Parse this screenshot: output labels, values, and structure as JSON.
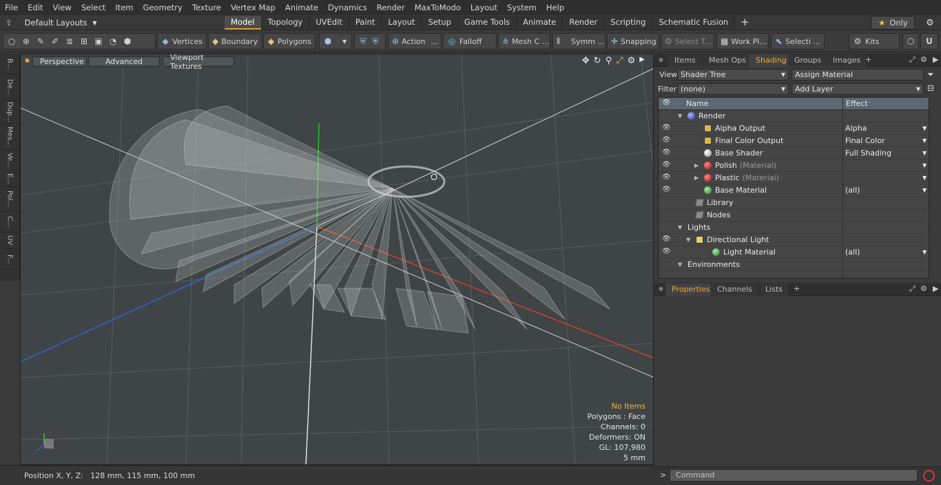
{
  "menu": [
    "File",
    "Edit",
    "View",
    "Select",
    "Item",
    "Geometry",
    "Texture",
    "Vertex Map",
    "Animate",
    "Dynamics",
    "Render",
    "MaxToModo",
    "Layout",
    "System",
    "Help"
  ],
  "layout": {
    "selector": "Default Layouts",
    "tabs": [
      "Model",
      "Topology",
      "UVEdit",
      "Paint",
      "Layout",
      "Setup",
      "Game Tools",
      "Animate",
      "Render",
      "Scripting",
      "Schematic Fusion"
    ],
    "active_tab": "Model",
    "only_label": "Only"
  },
  "toolbar": {
    "vertices": "Vertices",
    "boundary": "Boundary",
    "polygons": "Polygons",
    "action": "Action",
    "falloff": "Falloff",
    "mesh": "Mesh C ...",
    "symm": "Symm ...",
    "snapping": "Snapping",
    "select_t": "Select T...",
    "work_pl": "Work Pl...",
    "selecti": "Selecti ...",
    "kits": "Kits"
  },
  "left_tabs": [
    "B...",
    "De...",
    "Dup...",
    "Mes...",
    "Ve...",
    "E...",
    "Pol...",
    "C...",
    "UV",
    "F..."
  ],
  "viewport": {
    "perspective": "Perspective",
    "advanced": "Advanced",
    "textures": "Viewport Textures",
    "stats": {
      "no_items": "No Items",
      "polygons": "Polygons : Face",
      "channels": "Channels: 0",
      "deformers": "Deformers: ON",
      "gl": "GL: 107,980",
      "scale": "5 mm"
    }
  },
  "status": {
    "position": "Position X, Y, Z:   128 mm, 115 mm, 100 mm"
  },
  "right": {
    "tabs": [
      "Items",
      "Mesh Ops",
      "Shading",
      "Groups",
      "Images"
    ],
    "active_tab": "Shading",
    "view_label": "View",
    "view_value": "Shader Tree",
    "assign": "Assign Material",
    "filter_label": "Filter",
    "filter_value": "(none)",
    "add_layer": "Add Layer",
    "col_name": "Name",
    "col_effect": "Effect",
    "rows": [
      {
        "name": "Render",
        "sub": "",
        "effect": "",
        "eye": false,
        "exp": "▼",
        "ind": 0,
        "icon": "sphere-blue"
      },
      {
        "name": "Alpha Output",
        "sub": "",
        "effect": "Alpha",
        "eye": true,
        "exp": "",
        "ind": 2,
        "icon": "output"
      },
      {
        "name": "Final Color Output",
        "sub": "",
        "effect": "Final Color",
        "eye": true,
        "exp": "",
        "ind": 2,
        "icon": "output"
      },
      {
        "name": "Base Shader",
        "sub": "",
        "effect": "Full Shading",
        "eye": true,
        "exp": "",
        "ind": 2,
        "icon": "sphere-white"
      },
      {
        "name": "Polish",
        "sub": "(Material)",
        "effect": "",
        "eye": true,
        "exp": "▶",
        "ind": 2,
        "icon": "sphere-red"
      },
      {
        "name": "Plastic",
        "sub": "(Material)",
        "effect": "",
        "eye": true,
        "exp": "▶",
        "ind": 2,
        "icon": "sphere-red"
      },
      {
        "name": "Base Material",
        "sub": "",
        "effect": "(all)",
        "eye": true,
        "exp": "",
        "ind": 2,
        "icon": "sphere-green"
      },
      {
        "name": "Library",
        "sub": "",
        "effect": "",
        "eye": false,
        "exp": "",
        "ind": 1,
        "icon": "folder"
      },
      {
        "name": "Nodes",
        "sub": "",
        "effect": "",
        "eye": false,
        "exp": "",
        "ind": 1,
        "icon": "folder"
      },
      {
        "name": "Lights",
        "sub": "",
        "effect": "",
        "eye": false,
        "exp": "▼",
        "ind": 0,
        "icon": ""
      },
      {
        "name": "Directional Light",
        "sub": "",
        "effect": "",
        "eye": true,
        "exp": "▼",
        "ind": 1,
        "icon": "light"
      },
      {
        "name": "Light Material",
        "sub": "",
        "effect": "(all)",
        "eye": true,
        "exp": "",
        "ind": 3,
        "icon": "sphere-green"
      },
      {
        "name": "Environments",
        "sub": "",
        "effect": "",
        "eye": false,
        "exp": "▼",
        "ind": 0,
        "icon": ""
      }
    ],
    "ptabs": [
      "Properties",
      "Channels",
      "Lists"
    ],
    "active_ptab": "Properties",
    "command_placeholder": "Command"
  }
}
